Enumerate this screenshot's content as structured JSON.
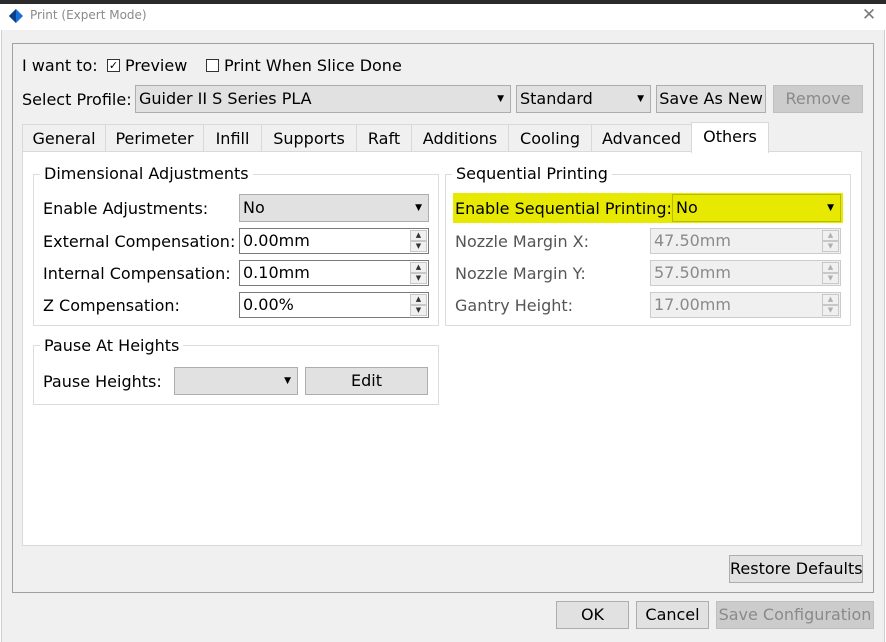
{
  "window": {
    "title": "Print (Expert Mode)",
    "close_glyph": "✕"
  },
  "top_row": {
    "i_want_to_label": "I want to:",
    "preview": {
      "label": "Preview",
      "checked": true
    },
    "print_when_done": {
      "label": "Print When Slice Done",
      "checked": false
    }
  },
  "profile": {
    "label": "Select Profile:",
    "selected": "Guider II S Series PLA",
    "quality": "Standard",
    "save_as_new": "Save As New",
    "remove": "Remove"
  },
  "tabs": [
    "General",
    "Perimeter",
    "Infill",
    "Supports",
    "Raft",
    "Additions",
    "Cooling",
    "Advanced",
    "Others"
  ],
  "active_tab": "Others",
  "dimensional": {
    "title": "Dimensional Adjustments",
    "enable_label": "Enable Adjustments:",
    "enable_value": "No",
    "external_label": "External Compensation:",
    "external_value": "0.00mm",
    "internal_label": "Internal Compensation:",
    "internal_value": "0.10mm",
    "z_label": "Z Compensation:",
    "z_value": "0.00%"
  },
  "pause": {
    "title": "Pause At Heights",
    "label": "Pause Heights:",
    "value": "",
    "edit": "Edit"
  },
  "sequential": {
    "title": "Sequential Printing",
    "enable_label": "Enable Sequential Printing:",
    "enable_value": "No",
    "nozzle_x_label": "Nozzle Margin X:",
    "nozzle_x_value": "47.50mm",
    "nozzle_y_label": "Nozzle Margin Y:",
    "nozzle_y_value": "57.50mm",
    "gantry_label": "Gantry Height:",
    "gantry_value": "17.00mm"
  },
  "restore_defaults": "Restore Defaults",
  "footer": {
    "ok": "OK",
    "cancel": "Cancel",
    "save_config": "Save Configuration"
  },
  "colors": {
    "highlight": "#e7ea00",
    "dialog_bg": "#f0f0f0",
    "button_bg": "#e1e1e1"
  }
}
